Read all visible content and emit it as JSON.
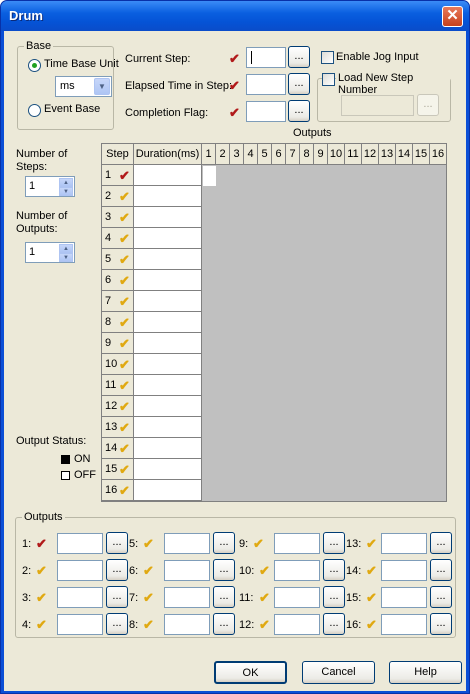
{
  "window": {
    "title": "Drum",
    "close_glyph": "✕"
  },
  "base": {
    "group_label": "Base",
    "time_base_label": "Time Base Unit",
    "time_unit_value": "ms",
    "event_base_label": "Event Base"
  },
  "step_fields": {
    "current_step_label": "Current Step:",
    "elapsed_label": "Elapsed Time in Step:",
    "completion_label": "Completion Flag:",
    "browse_label": "..."
  },
  "jog": {
    "enable_label": "Enable Jog Input",
    "load_new_label": "Load New Step Number"
  },
  "config": {
    "num_steps_label": "Number of Steps:",
    "num_steps_value": "1",
    "num_outputs_label": "Number of Outputs:",
    "num_outputs_value": "1",
    "output_status_label": "Output Status:",
    "on_label": "ON",
    "off_label": "OFF"
  },
  "table": {
    "outputs_caption": "Outputs",
    "step_header": "Step",
    "duration_header": "Duration(ms)",
    "output_columns": [
      "1",
      "2",
      "3",
      "4",
      "5",
      "6",
      "7",
      "8",
      "9",
      "10",
      "11",
      "12",
      "13",
      "14",
      "15",
      "16"
    ],
    "rows": [
      {
        "step": "1",
        "mark": "red"
      },
      {
        "step": "2",
        "mark": "yellow"
      },
      {
        "step": "3",
        "mark": "yellow"
      },
      {
        "step": "4",
        "mark": "yellow"
      },
      {
        "step": "5",
        "mark": "yellow"
      },
      {
        "step": "6",
        "mark": "yellow"
      },
      {
        "step": "7",
        "mark": "yellow"
      },
      {
        "step": "8",
        "mark": "yellow"
      },
      {
        "step": "9",
        "mark": "yellow"
      },
      {
        "step": "10",
        "mark": "yellow"
      },
      {
        "step": "11",
        "mark": "yellow"
      },
      {
        "step": "12",
        "mark": "yellow"
      },
      {
        "step": "13",
        "mark": "yellow"
      },
      {
        "step": "14",
        "mark": "yellow"
      },
      {
        "step": "15",
        "mark": "yellow"
      },
      {
        "step": "16",
        "mark": "yellow"
      }
    ]
  },
  "outputs_group": {
    "label": "Outputs",
    "items": [
      {
        "label": "1:",
        "mark": "red"
      },
      {
        "label": "5:",
        "mark": "yellow"
      },
      {
        "label": "9:",
        "mark": "yellow"
      },
      {
        "label": "13:",
        "mark": "yellow"
      },
      {
        "label": "2:",
        "mark": "yellow"
      },
      {
        "label": "6:",
        "mark": "yellow"
      },
      {
        "label": "10:",
        "mark": "yellow"
      },
      {
        "label": "14:",
        "mark": "yellow"
      },
      {
        "label": "3:",
        "mark": "yellow"
      },
      {
        "label": "7:",
        "mark": "yellow"
      },
      {
        "label": "11:",
        "mark": "yellow"
      },
      {
        "label": "15:",
        "mark": "yellow"
      },
      {
        "label": "4:",
        "mark": "yellow"
      },
      {
        "label": "8:",
        "mark": "yellow"
      },
      {
        "label": "12:",
        "mark": "yellow"
      },
      {
        "label": "16:",
        "mark": "yellow"
      }
    ]
  },
  "footer": {
    "ok_label": "OK",
    "cancel_label": "Cancel",
    "help_label": "Help"
  },
  "colors": {
    "titlebar": "#0553d6",
    "dialog_bg": "#ece9d8",
    "grid_bg": "#c0c0c0",
    "tick_red": "#b11a1a",
    "tick_yellow": "#e0a912"
  }
}
